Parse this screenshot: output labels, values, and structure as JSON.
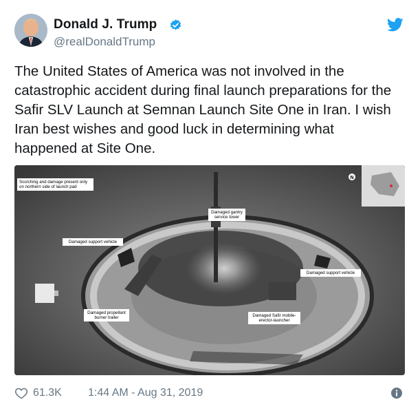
{
  "author": {
    "name": "Donald J. Trump",
    "handle": "@realDonaldTrump"
  },
  "tweet": {
    "text": "The United States of America was not involved in the catastrophic accident during final launch preparations for the Safir SLV Launch at Semnan Launch Site One in Iran. I wish Iran best wishes and good luck in determining what happened at Site One."
  },
  "media": {
    "labels": {
      "scorching": "Scorching and damage present only on northern side of launch pad",
      "gantry": "Damaged gantry service tower",
      "support_left": "Damaged support vehicle",
      "support_right": "Damaged support vehicle",
      "propellant": "Damaged propellant burner trailer",
      "safir": "Damaged Safir mobile-erector-launcher"
    }
  },
  "footer": {
    "likes": "61.3K",
    "timestamp": "1:44 AM - Aug 31, 2019"
  },
  "colors": {
    "verified": "#1da1f2",
    "twitter_brand": "#1da1f2",
    "secondary_text": "#657786"
  },
  "icons": [
    "verified-badge-icon",
    "twitter-bird-icon",
    "heart-icon",
    "info-icon"
  ]
}
